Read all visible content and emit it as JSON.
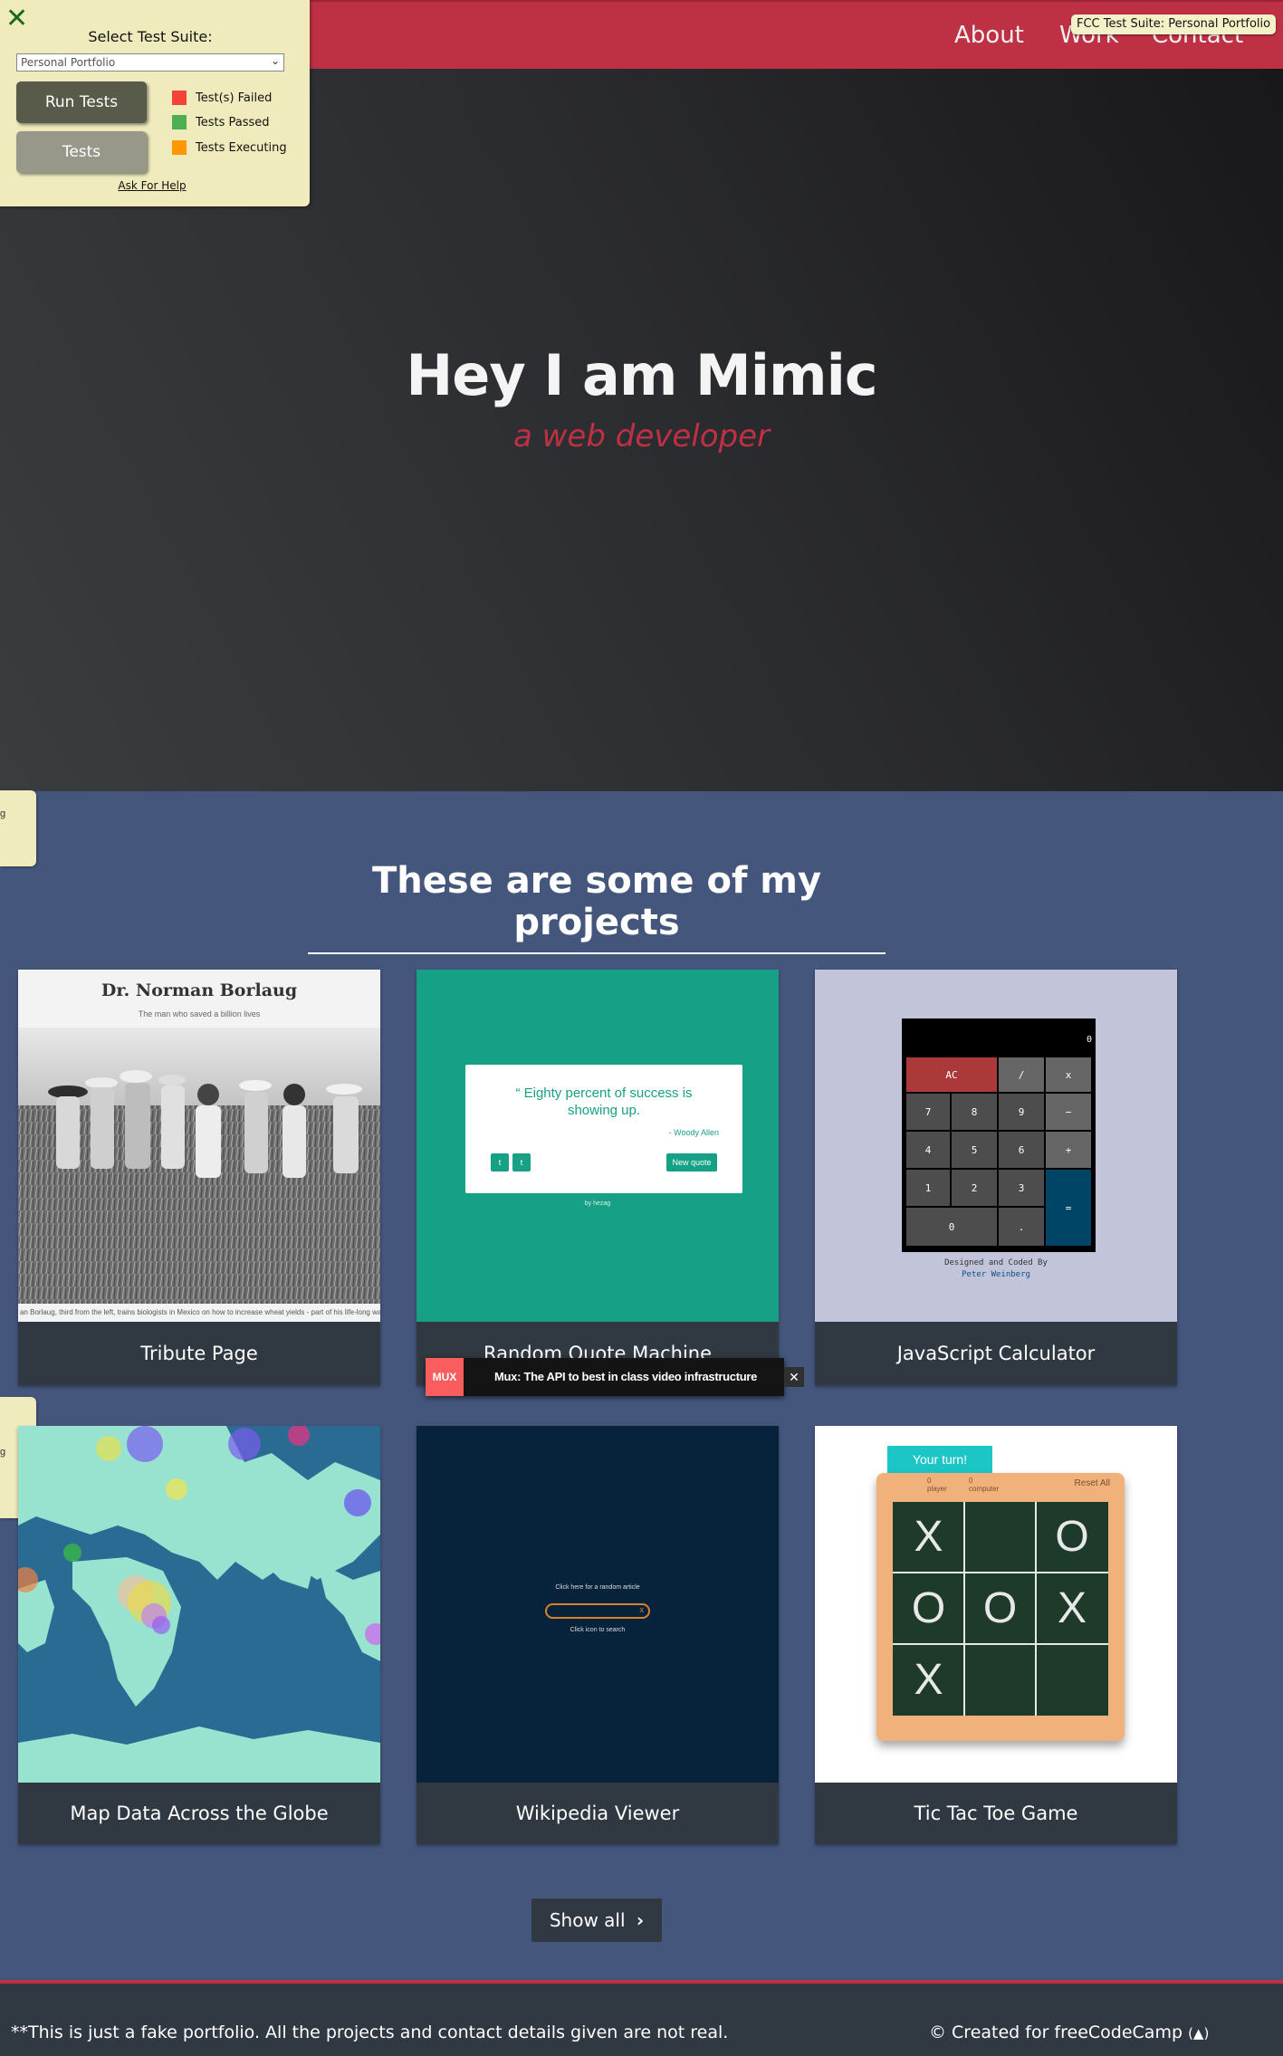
{
  "nav": {
    "about": "About",
    "work": "Work",
    "contact": "Contact"
  },
  "fcc": {
    "tooltip": "FCC Test Suite: Personal Portfolio",
    "close_icon": "close-x-icon",
    "suite_label": "Select Test Suite:",
    "selected_suite": "Personal Portfolio",
    "run_tests": "Run Tests",
    "tests": "Tests",
    "legend": [
      {
        "label": "Test(s) Failed",
        "color": "#f44336"
      },
      {
        "label": "Tests Passed",
        "color": "#4caf50"
      },
      {
        "label": "Tests Executing",
        "color": "#ff9800"
      }
    ],
    "ask_help": "Ask For Help",
    "side_tab_text": "g"
  },
  "hero": {
    "title": "Hey I am Mimic",
    "subtitle": "a web developer"
  },
  "projects": {
    "heading": "These are some of my projects",
    "tiles": [
      {
        "title": "Tribute Page"
      },
      {
        "title": "Random Quote Machine"
      },
      {
        "title": "JavaScript Calculator"
      },
      {
        "title": "Map Data Across the Globe"
      },
      {
        "title": "Wikipedia Viewer"
      },
      {
        "title": "Tic Tac Toe Game"
      }
    ],
    "show_all": "Show all"
  },
  "thumbs": {
    "tribute": {
      "title": "Dr. Norman Borlaug",
      "subtitle": "The man who saved a billion lives",
      "caption": "an Borlaug, third from the left, trains biologists in Mexico on how to increase wheat yields - part of his life-long war on"
    },
    "quote": {
      "text": "“ Eighty percent of success is showing up.",
      "author": "- Woody Allen",
      "new_quote": "New quote",
      "twitter": "t",
      "tumblr": "t",
      "by": "by hezag"
    },
    "calc": {
      "credit_line1": "Designed and Coded By",
      "credit_line2": "Peter Weinberg",
      "display": "0",
      "keys": [
        "AC",
        "/",
        "x",
        "7",
        "8",
        "9",
        "−",
        "4",
        "5",
        "6",
        "+",
        "1",
        "2",
        "3",
        "=",
        "0",
        "."
      ]
    },
    "wiki": {
      "hint_top": "Click here for a random article",
      "hint_bottom": "Click icon to search",
      "search_icon": "x"
    },
    "ttt": {
      "turn": "Your turn!",
      "player_label": "player",
      "computer_label": "computer",
      "reset": "Reset All",
      "player_score": "0",
      "computer_score": "0",
      "cells": [
        "X",
        "",
        "O",
        "O",
        "O",
        "X",
        "X",
        "",
        ""
      ]
    }
  },
  "ad": {
    "logo": "MUX",
    "text": "Mux: The API to best in class video infrastructure",
    "close": "✕"
  },
  "footer": {
    "disclaimer": "**This is just a fake portfolio. All the projects and contact details given are not real.",
    "credit": "© Created for freeCodeCamp"
  }
}
